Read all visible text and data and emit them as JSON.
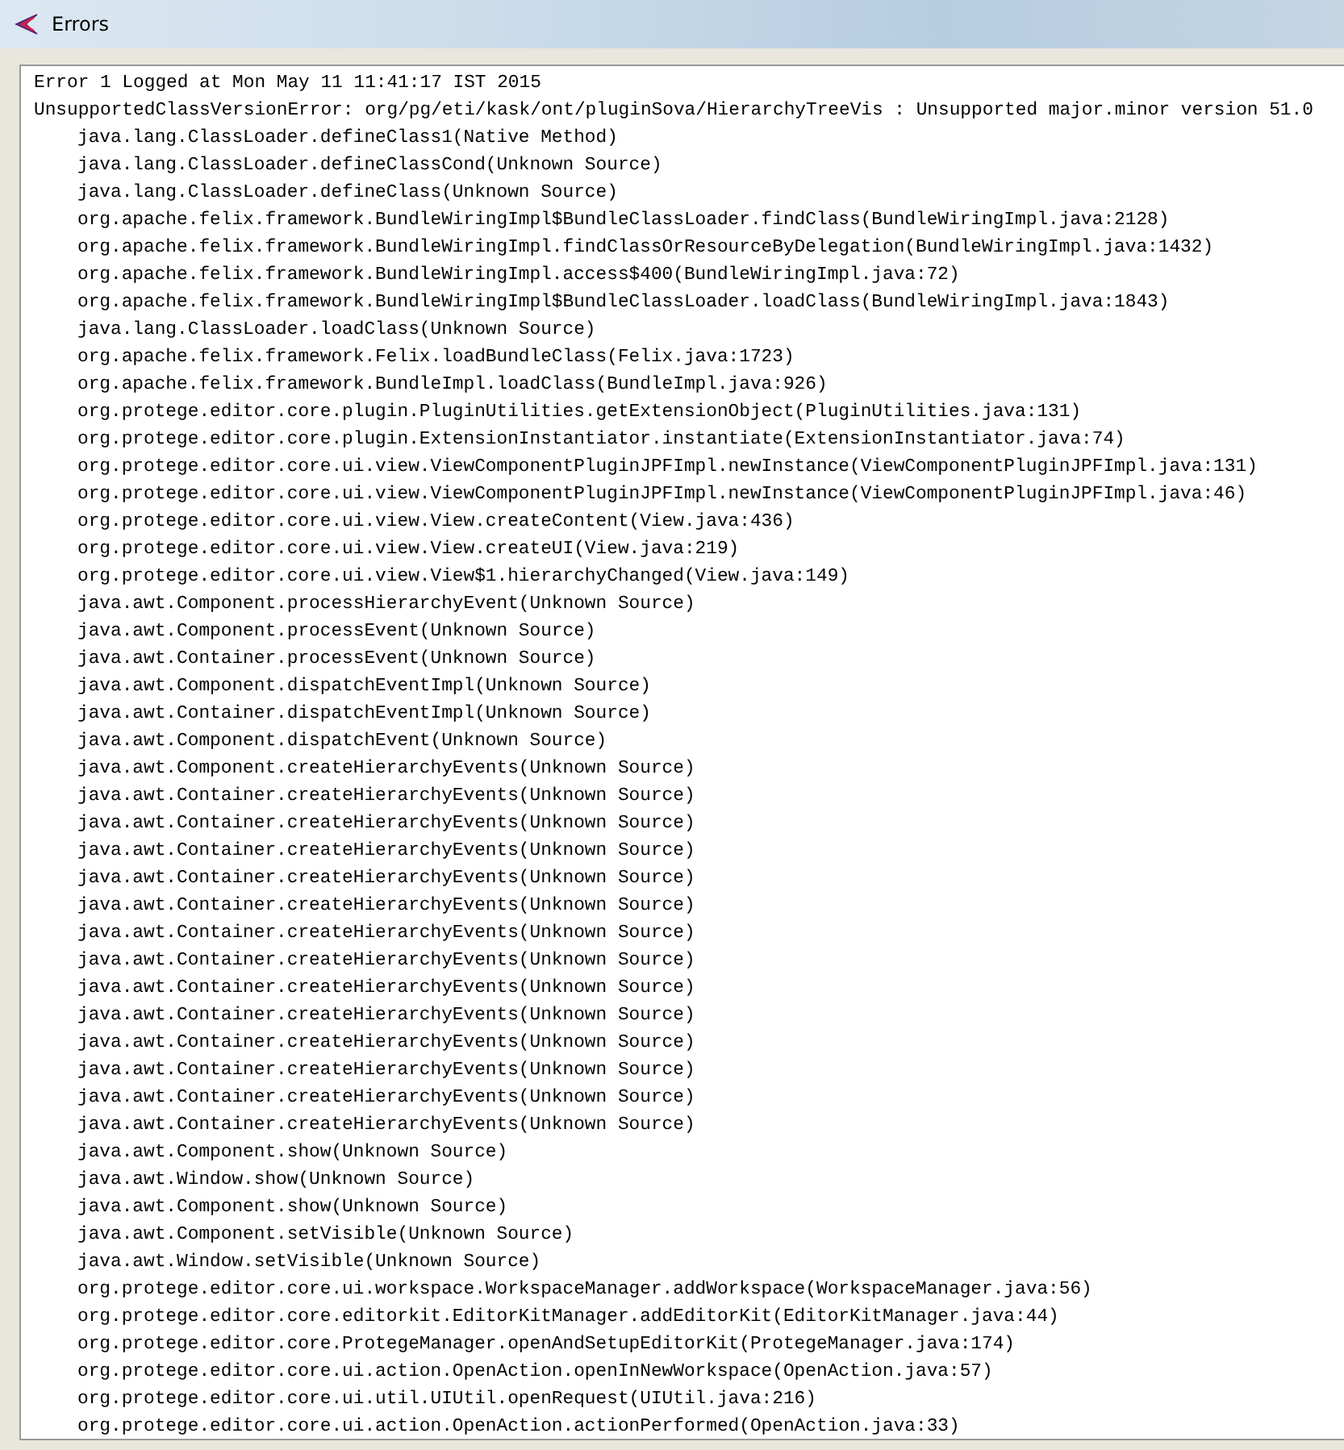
{
  "window": {
    "title": "Errors"
  },
  "log": {
    "header": [
      "Error 1 Logged at Mon May 11 11:41:17 IST 2015",
      "UnsupportedClassVersionError: org/pg/eti/kask/ont/pluginSova/HierarchyTreeVis : Unsupported major.minor version 51.0"
    ],
    "stack_frames": [
      "java.lang.ClassLoader.defineClass1(Native Method)",
      "java.lang.ClassLoader.defineClassCond(Unknown Source)",
      "java.lang.ClassLoader.defineClass(Unknown Source)",
      "org.apache.felix.framework.BundleWiringImpl$BundleClassLoader.findClass(BundleWiringImpl.java:2128)",
      "org.apache.felix.framework.BundleWiringImpl.findClassOrResourceByDelegation(BundleWiringImpl.java:1432)",
      "org.apache.felix.framework.BundleWiringImpl.access$400(BundleWiringImpl.java:72)",
      "org.apache.felix.framework.BundleWiringImpl$BundleClassLoader.loadClass(BundleWiringImpl.java:1843)",
      "java.lang.ClassLoader.loadClass(Unknown Source)",
      "org.apache.felix.framework.Felix.loadBundleClass(Felix.java:1723)",
      "org.apache.felix.framework.BundleImpl.loadClass(BundleImpl.java:926)",
      "org.protege.editor.core.plugin.PluginUtilities.getExtensionObject(PluginUtilities.java:131)",
      "org.protege.editor.core.plugin.ExtensionInstantiator.instantiate(ExtensionInstantiator.java:74)",
      "org.protege.editor.core.ui.view.ViewComponentPluginJPFImpl.newInstance(ViewComponentPluginJPFImpl.java:131)",
      "org.protege.editor.core.ui.view.ViewComponentPluginJPFImpl.newInstance(ViewComponentPluginJPFImpl.java:46)",
      "org.protege.editor.core.ui.view.View.createContent(View.java:436)",
      "org.protege.editor.core.ui.view.View.createUI(View.java:219)",
      "org.protege.editor.core.ui.view.View$1.hierarchyChanged(View.java:149)",
      "java.awt.Component.processHierarchyEvent(Unknown Source)",
      "java.awt.Component.processEvent(Unknown Source)",
      "java.awt.Container.processEvent(Unknown Source)",
      "java.awt.Component.dispatchEventImpl(Unknown Source)",
      "java.awt.Container.dispatchEventImpl(Unknown Source)",
      "java.awt.Component.dispatchEvent(Unknown Source)",
      "java.awt.Component.createHierarchyEvents(Unknown Source)",
      "java.awt.Container.createHierarchyEvents(Unknown Source)",
      "java.awt.Container.createHierarchyEvents(Unknown Source)",
      "java.awt.Container.createHierarchyEvents(Unknown Source)",
      "java.awt.Container.createHierarchyEvents(Unknown Source)",
      "java.awt.Container.createHierarchyEvents(Unknown Source)",
      "java.awt.Container.createHierarchyEvents(Unknown Source)",
      "java.awt.Container.createHierarchyEvents(Unknown Source)",
      "java.awt.Container.createHierarchyEvents(Unknown Source)",
      "java.awt.Container.createHierarchyEvents(Unknown Source)",
      "java.awt.Container.createHierarchyEvents(Unknown Source)",
      "java.awt.Container.createHierarchyEvents(Unknown Source)",
      "java.awt.Container.createHierarchyEvents(Unknown Source)",
      "java.awt.Container.createHierarchyEvents(Unknown Source)",
      "java.awt.Component.show(Unknown Source)",
      "java.awt.Window.show(Unknown Source)",
      "java.awt.Component.show(Unknown Source)",
      "java.awt.Component.setVisible(Unknown Source)",
      "java.awt.Window.setVisible(Unknown Source)",
      "org.protege.editor.core.ui.workspace.WorkspaceManager.addWorkspace(WorkspaceManager.java:56)",
      "org.protege.editor.core.editorkit.EditorKitManager.addEditorKit(EditorKitManager.java:44)",
      "org.protege.editor.core.ProtegeManager.openAndSetupEditorKit(ProtegeManager.java:174)",
      "org.protege.editor.core.ui.action.OpenAction.openInNewWorkspace(OpenAction.java:57)",
      "org.protege.editor.core.ui.util.UIUtil.openRequest(UIUtil.java:216)",
      "org.protege.editor.core.ui.action.OpenAction.actionPerformed(OpenAction.java:33)"
    ]
  }
}
